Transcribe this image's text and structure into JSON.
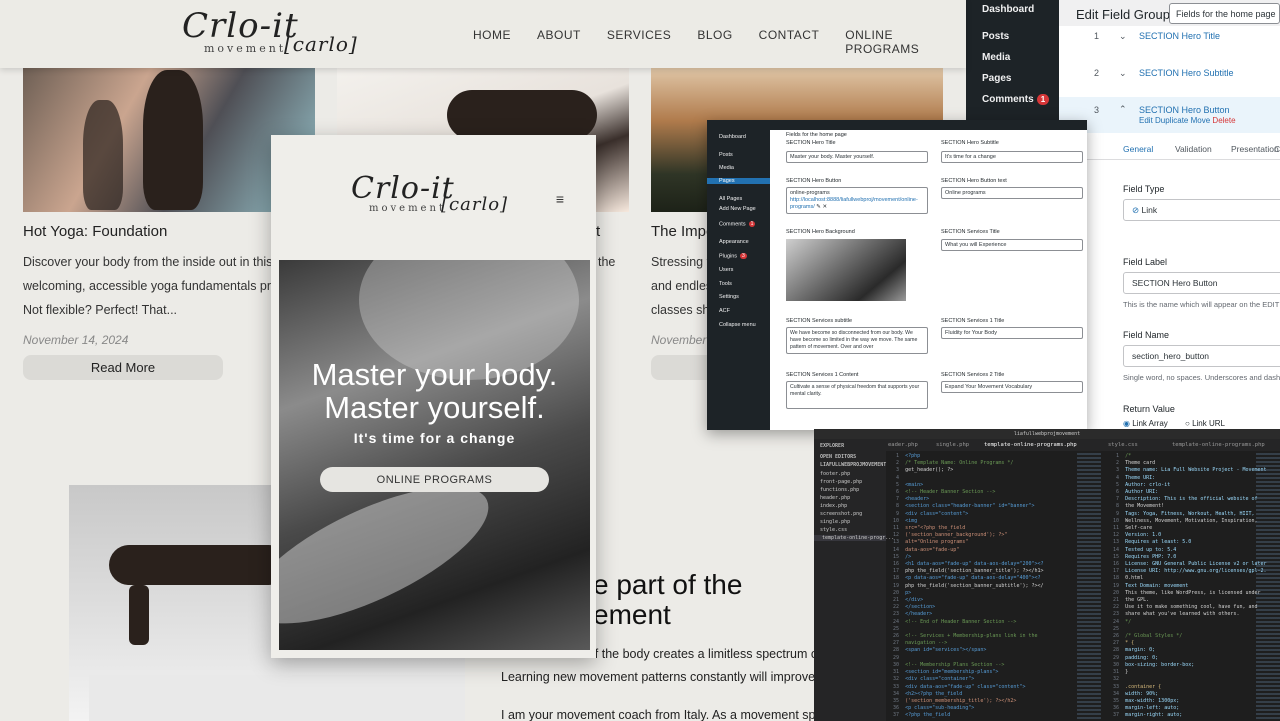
{
  "site": {
    "logo": {
      "script": "Crlo-it",
      "sub": "movement",
      "bracket": "[carlo]"
    },
    "nav": [
      "HOME",
      "ABOUT",
      "SERVICES",
      "BLOG",
      "CONTACT",
      "ONLINE PROGRAMS"
    ],
    "card1": {
      "title": "Hot Yoga: Foundation",
      "text": [
        "Discover your body from the inside out in this",
        "welcoming, accessible yoga fundamentals pra",
        "Not flexible? Perfect! That..."
      ],
      "date": "November 14, 2024",
      "button": "Read More"
    },
    "card2": {
      "title_fragment": "t",
      "text_fragment": "the"
    },
    "card3": {
      "title": "The Impo",
      "text": [
        "Stressing y",
        "and endles",
        "classes sho"
      ],
      "date": "November"
    },
    "section": {
      "heading": [
        "e part of the",
        "ement"
      ],
      "para1": "The movement of the body creates a limitless spectrum o",
      "para2": "Learning new movement patterns constantly will improve",
      "para3": "I am your movement coach from Italy. As a movement sp"
    }
  },
  "mobile": {
    "menu_icon": "hamburger-icon",
    "hero_title": [
      "Master your body.",
      "Master yourself."
    ],
    "hero_sub": "It's time for a change",
    "hero_button": "ONLINE PROGRAMS"
  },
  "wp": {
    "sidebar": [
      "Dashboard",
      "Posts",
      "Media",
      "Pages",
      "Comments"
    ],
    "comments_badge": "1",
    "page_title": "Edit Field Group",
    "title_input": "Fields for the home page",
    "rows": [
      {
        "num": "1",
        "label": "SECTION Hero Title"
      },
      {
        "num": "2",
        "label": "SECTION Hero Subtitle"
      },
      {
        "num": "3",
        "label": "SECTION Hero Button"
      }
    ],
    "row_actions": {
      "edit": "Edit",
      "duplicate": "Duplicate",
      "move": "Move",
      "delete": "Delete"
    },
    "tabs": [
      "General",
      "Validation",
      "Presentation",
      "C"
    ],
    "field_type_label": "Field Type",
    "field_type_value": "Link",
    "field_label_label": "Field Label",
    "field_label_value": "SECTION Hero Button",
    "field_label_help": "This is the name which will appear on the EDIT",
    "field_name_label": "Field Name",
    "field_name_value": "section_hero_button",
    "field_name_help": "Single word, no spaces. Underscores and dash",
    "return_label": "Return Value",
    "return_options": [
      "Link Array",
      "Link URL"
    ]
  },
  "wp2": {
    "sidebar": [
      "Dashboard",
      "Posts",
      "Media",
      "Pages",
      "All Pages",
      "Add New Page",
      "Comments",
      "Appearance",
      "Plugins",
      "Users",
      "Tools",
      "Settings",
      "ACF",
      "Collapse menu"
    ],
    "comments_badge": "1",
    "plugins_badge": "3",
    "heading": "Fields for the home page",
    "fields": {
      "hero_title_label": "SECTION Hero Title",
      "hero_title_value": "Master your body. Master yourself.",
      "hero_subtitle_label": "SECTION Hero Subtitle",
      "hero_subtitle_value": "It's time for a change",
      "hero_button_label": "SECTION Hero Button",
      "hero_button_value": "online-programs",
      "hero_button_url": "http://localhost:8888/liafullwebproj/movement/online-programs/",
      "hero_button_text_label": "SECTION Hero Button text",
      "hero_button_text_value": "Online programs",
      "hero_bg_label": "SECTION Hero Background",
      "services_title_label": "SECTION Services Title",
      "services_title_value": "What you will Experience",
      "services_subtitle_label": "SECTION Services subtitle",
      "services_subtitle_value": "We have become so disconnected from our body. We have become so limited in the way we move. The same pattern of movement. Over and over",
      "services1_title_label": "SECTION Services 1 Title",
      "services1_title_value": "Fluidity for Your Body",
      "services1_content_label": "SECTION Services 1 Content",
      "services1_content_value": "Cultivate a sense of physical freedom that supports your mental clarity.",
      "services2_title_label": "SECTION Services 2 Title",
      "services2_title_value": "Expand Your Movement Vocabulary"
    }
  },
  "vscode": {
    "title": "liafullwebprojmovement",
    "tabs": [
      "eader.php",
      "single.php",
      "template-online-programs.php",
      "style.css",
      "template-online-programs.php"
    ],
    "explorer_heading": "EXPLORER",
    "open_editors": "OPEN EDITORS",
    "project": "LIAFULLWEBPROJMOVEMENT",
    "files": [
      "footer.php",
      "front-page.php",
      "functions.php",
      "header.php",
      "index.php",
      "screenshot.png",
      "single.php",
      "style.css",
      "template-online-progr..."
    ],
    "code_left": [
      "<?php",
      "/* Template Name: Online Programs */",
      "get_header(); ?>",
      "",
      "<main>",
      "<!-- Header Banner Section -->",
      "<header>",
      "<section class=\"header-banner\" id=\"banner\">",
      "<div class=\"content\">",
      "<img",
      "src=\"<?php the_field",
      "('section_banner_background'); ?>\"",
      "alt=\"Online programs\"",
      "data-aos=\"fade-up\"",
      "/>",
      "<h1 data-aos=\"fade-up\" data-aos-delay=\"200\"><?",
      "php the_field('section_banner_title'); ?></h1>",
      "<p data-aos=\"fade-up\" data-aos-delay=\"400\"><?",
      "php the_field('section_banner_subtitle'); ?></",
      "p>",
      "</div>",
      "</section>",
      "</header>",
      "<!-- End of Header Banner Section -->",
      "",
      "<!-- Services + Membership-plans link in the",
      "navigation -->",
      "<span id=\"services\"></span>",
      "",
      "<!-- Membership Plans Section -->",
      "<section id=\"membership-plans\">",
      "<div class=\"container\">",
      "<div data-aos=\"fade-up\" class=\"content\">",
      "<h2><?php the_field",
      "('section_membership_title'); ?></h2>",
      "<p class=\"sub-heading\">",
      "<?php the_field"
    ],
    "code_right": [
      "/*",
      "Theme card",
      "Theme name: Lia Full Website Project - Movement",
      "Theme URI:",
      "Author: crlo-it",
      "Author URI:",
      "Description: This is the official website of",
      "the Movement!",
      "Tags: Yoga, Fitness, Workout, Health, HIIT,",
      "Wellness, Movement, Motivation, Inspiration,",
      "Self-care",
      "Version: 1.0",
      "Requires at least: 5.0",
      "Tested up to: 5.4",
      "Requires PHP: 7.0",
      "License: GNU General Public License v2 or later",
      "License URI: http://www.gnu.org/licenses/gpl-2.",
      "0.html",
      "Text Domain: movement",
      "This theme, like WordPress, is licensed under",
      "the GPL.",
      "Use it to make something cool, have fun, and",
      "share what you've learned with others.",
      "*/",
      "",
      "/* Global Styles */",
      "* {",
      "margin: 0;",
      "padding: 0;",
      "box-sizing: border-box;",
      "}",
      "",
      ".container {",
      "width: 90%;",
      "max-width: 1300px;",
      "margin-left: auto;",
      "margin-right: auto;"
    ]
  }
}
